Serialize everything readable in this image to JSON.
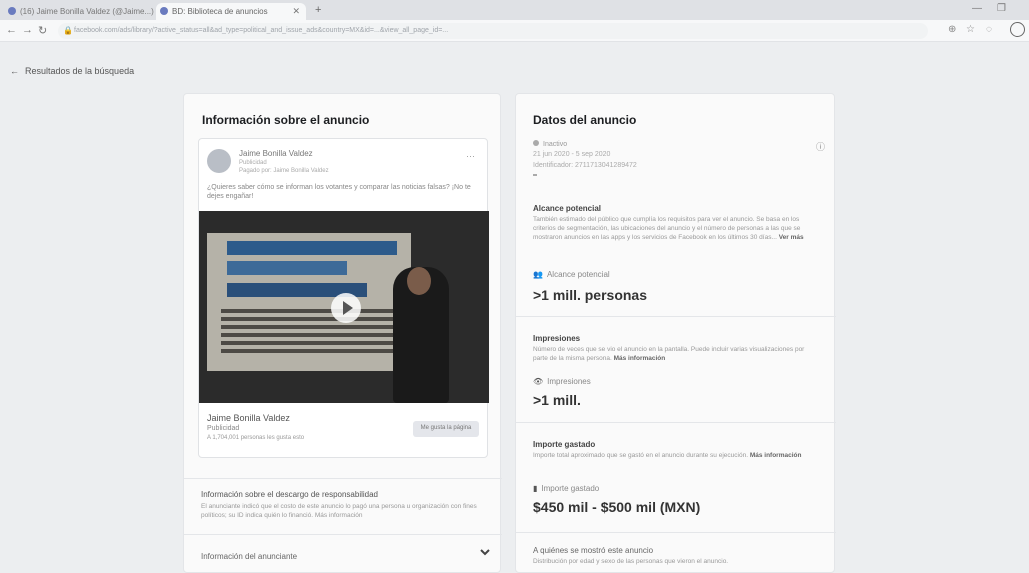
{
  "browser": {
    "tabs": [
      {
        "label": "(16) Jaime Bonilla Valdez (@Jaime...)"
      },
      {
        "label": "BD: Biblioteca de anuncios"
      }
    ],
    "url": "facebook.com/ads/library/?active_status=all&ad_type=political_and_issue_ads&country=MX&id=...&view_all_page_id=..."
  },
  "page": {
    "back_label": "Resultados de la búsqueda"
  },
  "left": {
    "title": "Información sobre el anuncio",
    "ad": {
      "page_name": "Jaime Bonilla Valdez",
      "sponsored": "Publicidad",
      "paid_by": "Pagado por: Jaime Bonilla Valdez",
      "body": "¿Quieres saber cómo se informan los votantes y comparar las noticias falsas? ¡No te dejes engañar!",
      "footer_name": "Jaime Bonilla Valdez",
      "footer_sub": "Publicidad",
      "footer_sub2": "A 1,704,001 personas les gusta esto",
      "footer_button": "Me gusta la página"
    },
    "disclaimer_title": "Información sobre el descargo de responsabilidad",
    "disclaimer_text": "El anunciante indicó que el costo de este anuncio lo pagó una persona u organización con fines políticos; su ID indica quién lo financió. Más información",
    "advertiser_label": "Información del anunciante"
  },
  "right": {
    "title": "Datos del anuncio",
    "status": "Inactivo",
    "dates": "21 jun 2020 - 5 sep 2020",
    "ad_id": "Identificador: 2711713041289472",
    "reach": {
      "title": "Alcance potencial",
      "text": "También estimado del público que cumplía los requisitos para ver el anuncio. Se basa en los criterios de segmentación, las ubicaciones del anuncio y el número de personas a las que se mostraron anuncios en las apps y los servicios de Facebook en los últimos 30 días...",
      "more": "Ver más",
      "label": "Alcance potencial",
      "value": ">1 mill. personas"
    },
    "impressions": {
      "title": "Impresiones",
      "text": "Número de veces que se vio el anuncio en la pantalla. Puede incluir varias visualizaciones por parte de la misma persona.",
      "more": "Más información",
      "label": "Impresiones",
      "value": ">1 mill."
    },
    "spend": {
      "title": "Importe gastado",
      "text": "Importe total aproximado que se gastó en el anuncio durante su ejecución.",
      "more": "Más información",
      "label": "Importe gastado",
      "value": "$450 mil - $500 mil (MXN)"
    },
    "who": {
      "title": "A quiénes se mostró este anuncio",
      "text": "Distribución por edad y sexo de las personas que vieron el anuncio."
    }
  }
}
